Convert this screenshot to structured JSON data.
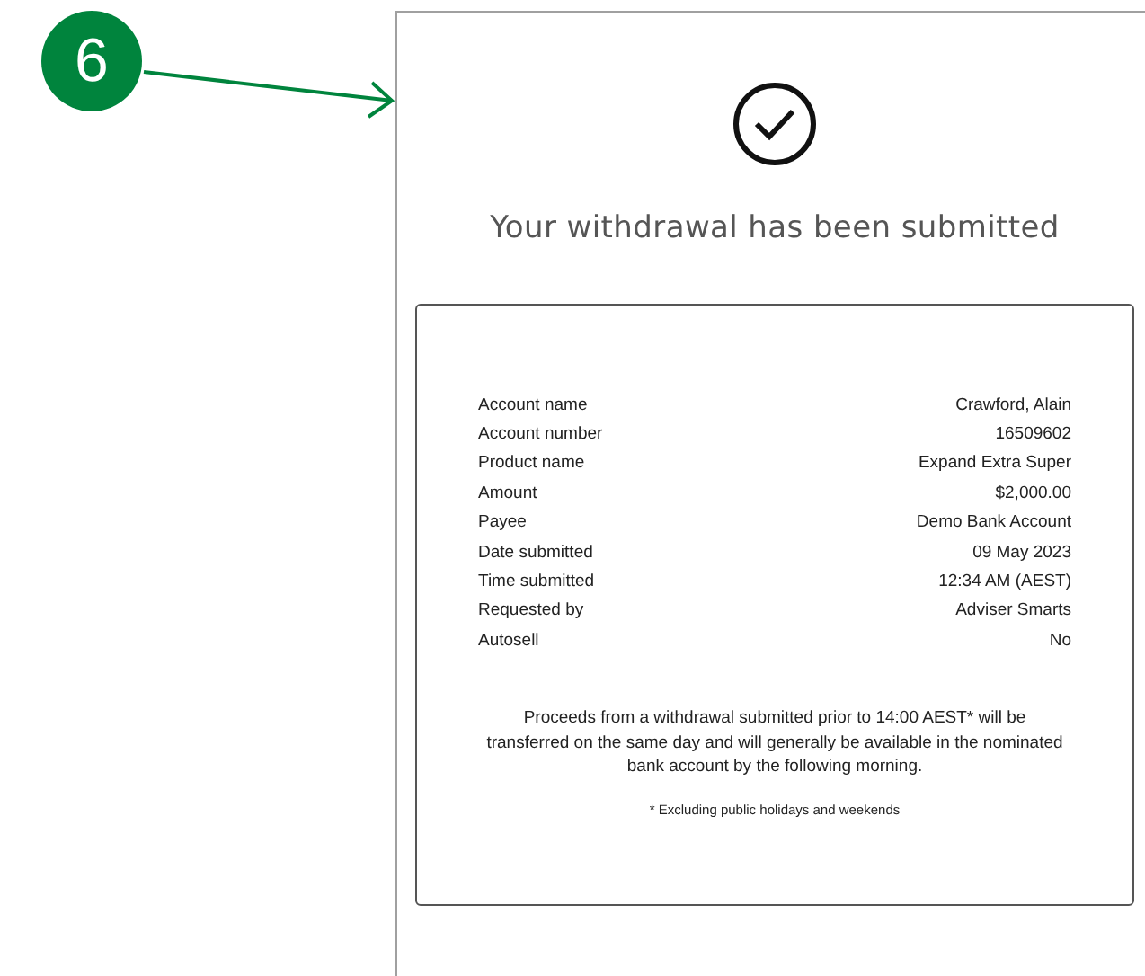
{
  "callout": {
    "number": "6"
  },
  "confirmation": {
    "title": "Your withdrawal has been submitted"
  },
  "details": [
    {
      "label": "Account name",
      "value": "Crawford, Alain"
    },
    {
      "label": "Account number",
      "value": "16509602"
    },
    {
      "label": "Product name",
      "value": "Expand Extra Super"
    },
    {
      "label": "Amount",
      "value": "$2,000.00"
    },
    {
      "label": "Payee",
      "value": "Demo Bank Account"
    },
    {
      "label": "Date submitted",
      "value": "09 May 2023"
    },
    {
      "label": "Time submitted",
      "value": "12:34 AM (AEST)"
    },
    {
      "label": "Requested by",
      "value": "Adviser Smarts"
    },
    {
      "label": "Autosell",
      "value": "No"
    }
  ],
  "notice": "Proceeds from a withdrawal submitted prior to 14:00 AEST* will be transferred on the same day and will generally be available in the nominated bank account by the following morning.",
  "footnote": "* Excluding public holidays and weekends"
}
